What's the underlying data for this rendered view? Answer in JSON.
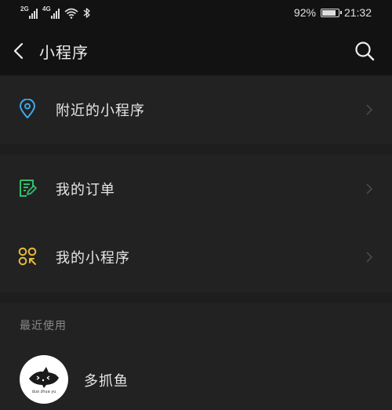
{
  "status_bar": {
    "network1": "2G",
    "network2": "4G",
    "battery_text": "92%",
    "battery_level": 0.92,
    "time": "21:32"
  },
  "header": {
    "title": "小程序",
    "back_icon": "chevron-left-icon",
    "search_icon": "search-icon"
  },
  "menu": {
    "nearby": {
      "label": "附近的小程序",
      "icon": "location-pin-icon",
      "color": "#3fa8e8"
    },
    "orders": {
      "label": "我的订单",
      "icon": "order-list-icon",
      "color": "#2fbf6a"
    },
    "my_programs": {
      "label": "我的小程序",
      "icon": "mini-program-grid-icon",
      "color": "#e8b93a"
    }
  },
  "recent": {
    "title": "最近使用",
    "items": [
      {
        "name": "多抓鱼",
        "logo_icon": "fish-logo-icon",
        "logo_text": "duo zhua yu"
      }
    ]
  },
  "colors": {
    "background": "#1e1e1e",
    "bar": "#121212",
    "card": "#222222",
    "text": "#e6e6e6",
    "muted": "#8a8a8a"
  }
}
